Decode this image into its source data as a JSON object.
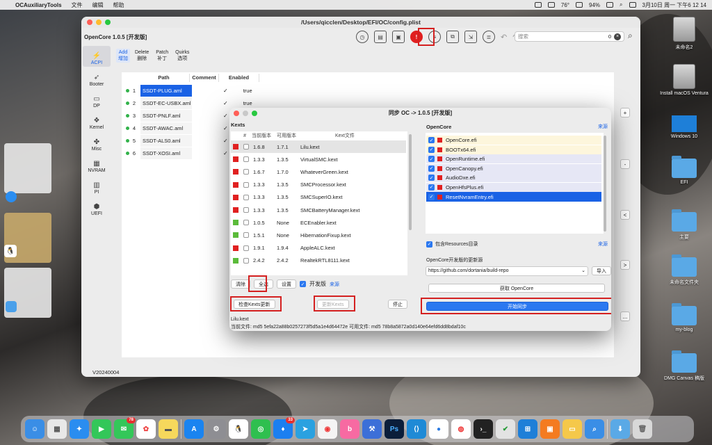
{
  "menubar": {
    "app": "OCAuxiliaryTools",
    "menus": [
      "文件",
      "编辑",
      "帮助"
    ],
    "temperature": "76°",
    "battery": "94%",
    "datetime": "3月10日 周一 下午6 12 14"
  },
  "desktop": {
    "icons": [
      "未命名2",
      "Install macOS Ventura",
      "Windows 10",
      "EFI",
      "主要",
      "未命名文件夹",
      "my-blog",
      "DMG Canvas 稿版"
    ]
  },
  "window": {
    "title": "/Users/qicclen/Desktop/EFI/OC/config.plist",
    "version_label": "OpenCore 1.0.5 [开发版]",
    "search": {
      "placeholder": "搜索",
      "count": "0"
    },
    "footer_version": "V20240004"
  },
  "sidebar": {
    "items": [
      {
        "label": "ACPI",
        "icon": "bolt-icon"
      },
      {
        "label": "Booter",
        "icon": "rocket-icon"
      },
      {
        "label": "DP",
        "icon": "display-icon"
      },
      {
        "label": "Kernel",
        "icon": "kernel-icon"
      },
      {
        "label": "Misc",
        "icon": "misc-icon"
      },
      {
        "label": "NVRAM",
        "icon": "chip-icon"
      },
      {
        "label": "PI",
        "icon": "pi-icon"
      },
      {
        "label": "UEFI",
        "icon": "cube-icon"
      }
    ]
  },
  "subtabs": [
    {
      "en": "Add",
      "cn": "增加"
    },
    {
      "en": "Delete",
      "cn": "删除"
    },
    {
      "en": "Patch",
      "cn": "补丁"
    },
    {
      "en": "Quirks",
      "cn": "选项"
    }
  ],
  "acpi": {
    "headers": [
      "Path",
      "Comment",
      "Enabled"
    ],
    "rows": [
      {
        "no": "1",
        "path": "SSDT-PLUG.aml",
        "enabled": "true"
      },
      {
        "no": "2",
        "path": "SSDT-EC-USBX.aml",
        "enabled": "true"
      },
      {
        "no": "3",
        "path": "SSDT-PNLF.aml",
        "enabled": ""
      },
      {
        "no": "4",
        "path": "SSDT-AWAC.aml",
        "enabled": ""
      },
      {
        "no": "5",
        "path": "SSDT-ALS0.aml",
        "enabled": ""
      },
      {
        "no": "6",
        "path": "SSDT-XOSI.aml",
        "enabled": ""
      }
    ],
    "side_buttons": [
      "+",
      "-",
      "<",
      ">",
      "..."
    ]
  },
  "dialog": {
    "title": "同步 OC -> 1.0.5 [开发版]",
    "kexts": {
      "section": "Kexts",
      "headers": [
        "#",
        "当前版本",
        "可用版本",
        "Kext文件"
      ],
      "rows": [
        {
          "cur": "1.6.8",
          "avail": "1.7.1",
          "file": "Lilu.kext",
          "color": "red"
        },
        {
          "cur": "1.3.3",
          "avail": "1.3.5",
          "file": "VirtualSMC.kext",
          "color": "red"
        },
        {
          "cur": "1.6.7",
          "avail": "1.7.0",
          "file": "WhateverGreen.kext",
          "color": "red"
        },
        {
          "cur": "1.3.3",
          "avail": "1.3.5",
          "file": "SMCProcessor.kext",
          "color": "red"
        },
        {
          "cur": "1.3.3",
          "avail": "1.3.5",
          "file": "SMCSuperIO.kext",
          "color": "red"
        },
        {
          "cur": "1.3.3",
          "avail": "1.3.5",
          "file": "SMCBatteryManager.kext",
          "color": "red"
        },
        {
          "cur": "1.0.5",
          "avail": "None",
          "file": "ECEnabler.kext",
          "color": "green"
        },
        {
          "cur": "1.5.1",
          "avail": "None",
          "file": "HibernationFixup.kext",
          "color": "green"
        },
        {
          "cur": "1.9.1",
          "avail": "1.9.4",
          "file": "AppleALC.kext",
          "color": "red"
        },
        {
          "cur": "2.4.2",
          "avail": "2.4.2",
          "file": "RealtekRTL8111.kext",
          "color": "green"
        }
      ],
      "buttons": {
        "clear": "清除",
        "select_all": "全选",
        "settings": "设置",
        "dev": "开发版",
        "source": "来源"
      },
      "check_update": "检查Kexts更新",
      "update": "更新Kexts",
      "stop": "停止"
    },
    "opencore": {
      "section": "OpenCore",
      "source": "来源",
      "files": [
        "OpenCore.efi",
        "BOOTx64.efi",
        "OpenRuntime.efi",
        "OpenCanopy.efi",
        "AudioDxe.efi",
        "OpenHfsPlus.efi",
        "ResetNvramEntry.efi"
      ],
      "include_resources": "包含Resources目录",
      "resources_source": "来源",
      "update_source_label": "OpenCore开发版的更新源",
      "update_url": "https://github.com/dortania/build-repo",
      "import": "导入",
      "get": "获取 OpenCore",
      "start": "开始同步"
    },
    "info": {
      "name": "Lilu.kext",
      "line": "当前文件:   md5   5efa22a88b0257273f5d5a1e4d64472e    可用文件:   md5   78b8a5872a0d140e64efd6dd8bdaf10c"
    }
  },
  "dock": {
    "messages_badge": "78",
    "qq_badge": "33"
  }
}
